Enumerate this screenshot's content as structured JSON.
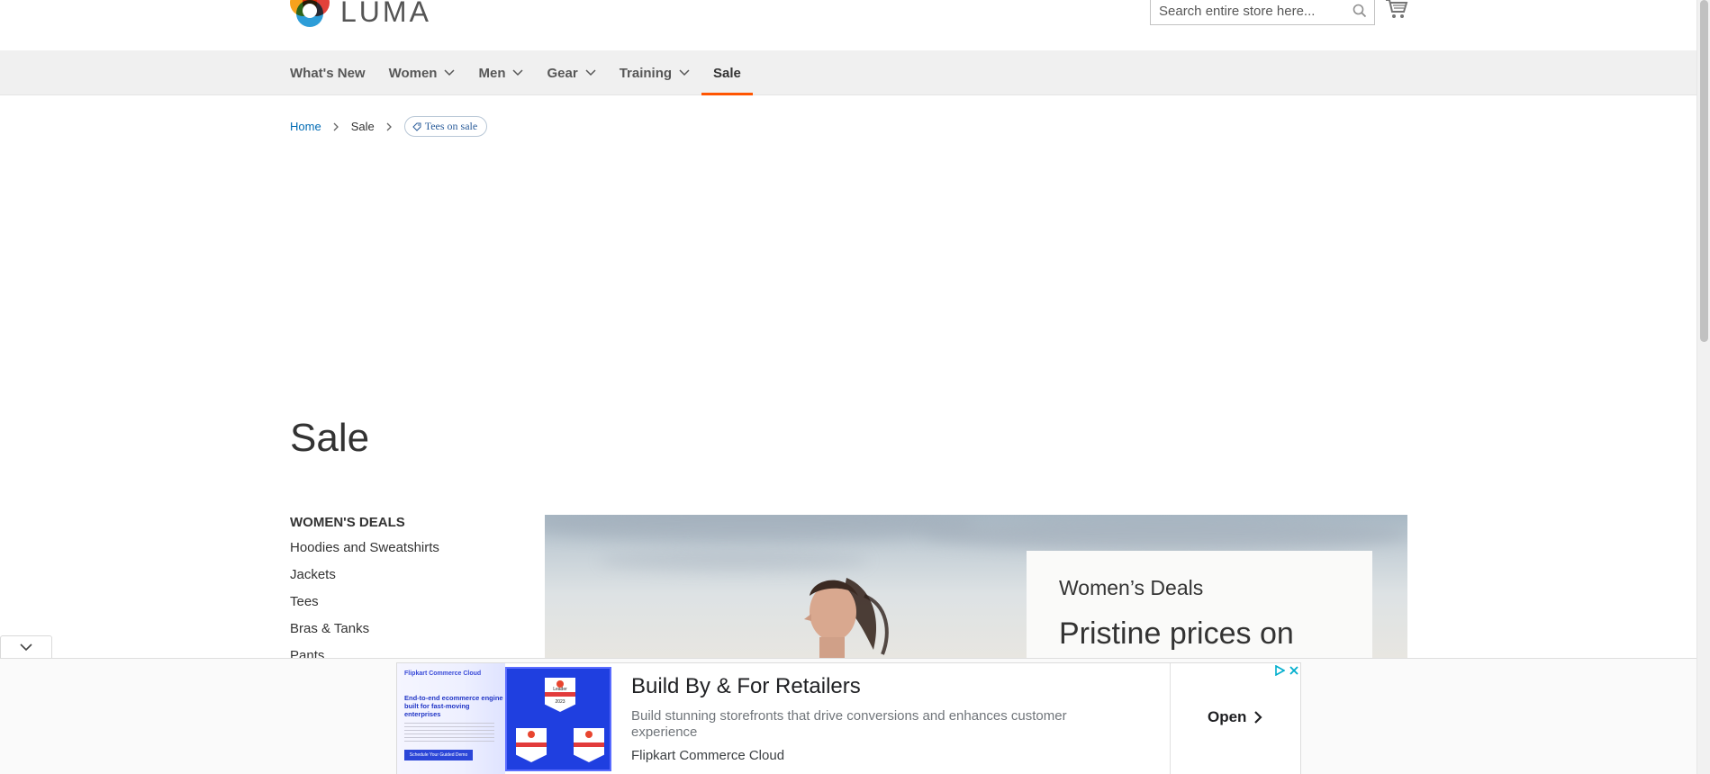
{
  "header": {
    "logo_text": "LUMA",
    "search_placeholder": "Search entire store here..."
  },
  "nav": {
    "items": [
      {
        "label": "What's New",
        "has_menu": false
      },
      {
        "label": "Women",
        "has_menu": true
      },
      {
        "label": "Men",
        "has_menu": true
      },
      {
        "label": "Gear",
        "has_menu": true
      },
      {
        "label": "Training",
        "has_menu": true
      },
      {
        "label": "Sale",
        "has_menu": false,
        "active": true
      }
    ],
    "active_color": "#ff5501"
  },
  "breadcrumb": {
    "home": "Home",
    "current": "Sale",
    "tag": "Tees on sale"
  },
  "page": {
    "title": "Sale"
  },
  "sidebar": {
    "heading": "WOMEN'S DEALS",
    "links": [
      "Hoodies and Sweatshirts",
      "Jackets",
      "Tees",
      "Bras & Tanks",
      "Pants"
    ]
  },
  "hero": {
    "subtitle": "Women’s Deals",
    "title": "Pristine prices on"
  },
  "ad": {
    "thumb_brand": "Flipkart Commerce Cloud",
    "thumb_headline": "End-to-end ecommerce engine built for fast-moving enterprises",
    "thumb_button": "Schedule Your Guided Demo",
    "badge_label": "Leader",
    "badge_year": "2023",
    "title": "Build By & For Retailers",
    "description": "Build stunning storefronts that drive conversions and enhances customer experience",
    "advertiser": "Flipkart Commerce Cloud",
    "cta": "Open"
  }
}
